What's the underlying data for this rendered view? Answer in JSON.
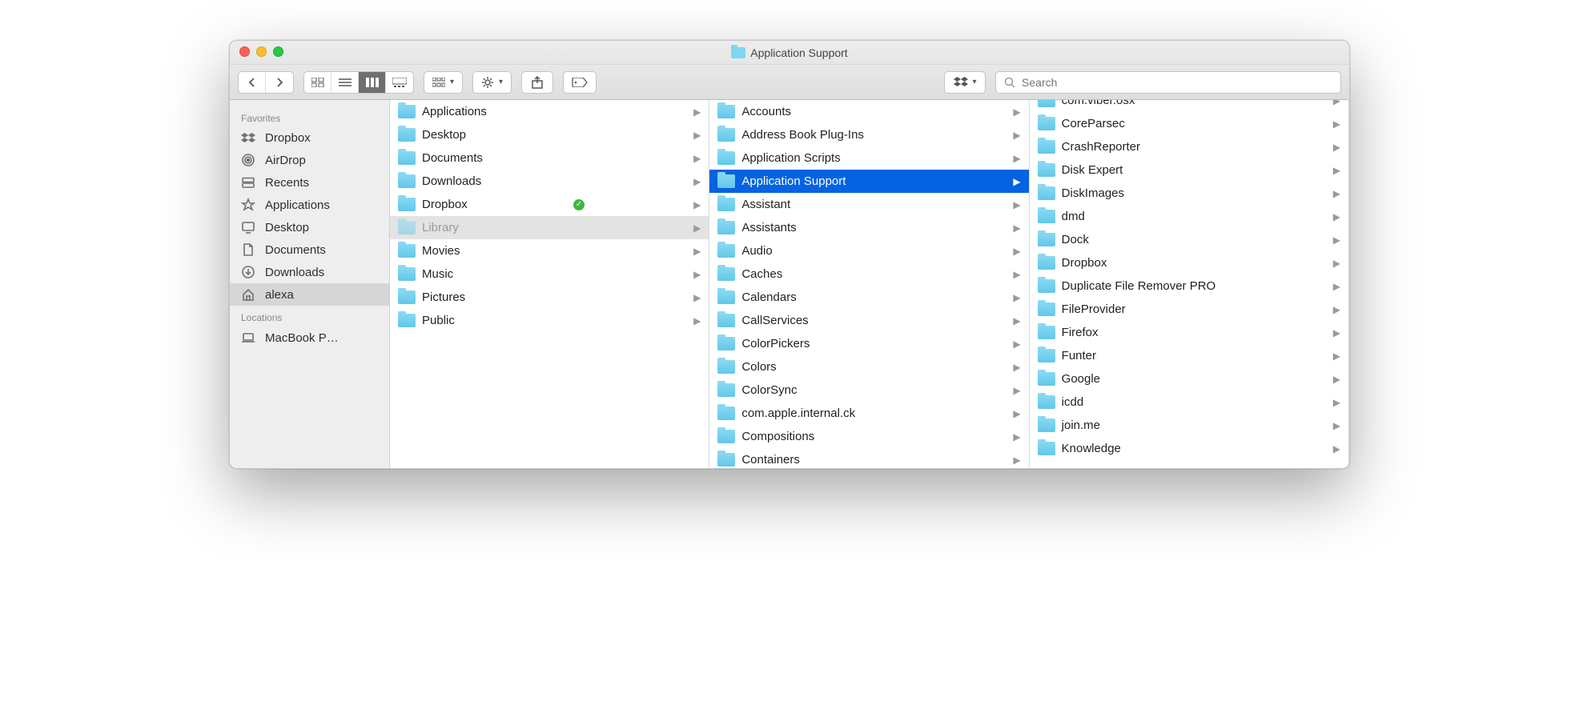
{
  "title": "Application Support",
  "search": {
    "placeholder": "Search"
  },
  "sidebar": {
    "sections": [
      {
        "header": "Favorites",
        "items": [
          {
            "label": "Dropbox",
            "icon": "dropbox"
          },
          {
            "label": "AirDrop",
            "icon": "airdrop"
          },
          {
            "label": "Recents",
            "icon": "recents"
          },
          {
            "label": "Applications",
            "icon": "applications"
          },
          {
            "label": "Desktop",
            "icon": "desktop"
          },
          {
            "label": "Documents",
            "icon": "documents"
          },
          {
            "label": "Downloads",
            "icon": "downloads"
          },
          {
            "label": "alexa",
            "icon": "home",
            "selected": true
          }
        ]
      },
      {
        "header": "Locations",
        "items": [
          {
            "label": "MacBook P…",
            "icon": "laptop"
          }
        ]
      }
    ]
  },
  "columns": [
    {
      "items": [
        {
          "label": "Applications",
          "arrow": true
        },
        {
          "label": "Desktop",
          "arrow": true
        },
        {
          "label": "Documents",
          "arrow": true
        },
        {
          "label": "Downloads",
          "arrow": true
        },
        {
          "label": "Dropbox",
          "arrow": true,
          "sync": true
        },
        {
          "label": "Library",
          "arrow": true,
          "state": "gray"
        },
        {
          "label": "Movies",
          "arrow": true
        },
        {
          "label": "Music",
          "arrow": true
        },
        {
          "label": "Pictures",
          "arrow": true
        },
        {
          "label": "Public",
          "arrow": true
        }
      ]
    },
    {
      "items": [
        {
          "label": "Accounts",
          "arrow": true
        },
        {
          "label": "Address Book Plug-Ins",
          "arrow": true
        },
        {
          "label": "Application Scripts",
          "arrow": true
        },
        {
          "label": "Application Support",
          "arrow": true,
          "state": "blue"
        },
        {
          "label": "Assistant",
          "arrow": true
        },
        {
          "label": "Assistants",
          "arrow": true
        },
        {
          "label": "Audio",
          "arrow": true
        },
        {
          "label": "Caches",
          "arrow": true
        },
        {
          "label": "Calendars",
          "arrow": true
        },
        {
          "label": "CallServices",
          "arrow": true
        },
        {
          "label": "ColorPickers",
          "arrow": true
        },
        {
          "label": "Colors",
          "arrow": true
        },
        {
          "label": "ColorSync",
          "arrow": true
        },
        {
          "label": "com.apple.internal.ck",
          "arrow": true
        },
        {
          "label": "Compositions",
          "arrow": true
        },
        {
          "label": "Containers",
          "arrow": true
        }
      ]
    },
    {
      "scrolled": true,
      "items": [
        {
          "label": "com.viber.osx",
          "arrow": true,
          "partial_top": true
        },
        {
          "label": "CoreParsec",
          "arrow": true
        },
        {
          "label": "CrashReporter",
          "arrow": true
        },
        {
          "label": "Disk Expert",
          "arrow": true
        },
        {
          "label": "DiskImages",
          "arrow": true
        },
        {
          "label": "dmd",
          "arrow": true
        },
        {
          "label": "Dock",
          "arrow": true
        },
        {
          "label": "Dropbox",
          "arrow": true
        },
        {
          "label": "Duplicate File Remover PRO",
          "arrow": true
        },
        {
          "label": "FileProvider",
          "arrow": true
        },
        {
          "label": "Firefox",
          "arrow": true
        },
        {
          "label": "Funter",
          "arrow": true
        },
        {
          "label": "Google",
          "arrow": true
        },
        {
          "label": "icdd",
          "arrow": true
        },
        {
          "label": "join.me",
          "arrow": true
        },
        {
          "label": "Knowledge",
          "arrow": true
        }
      ]
    }
  ]
}
